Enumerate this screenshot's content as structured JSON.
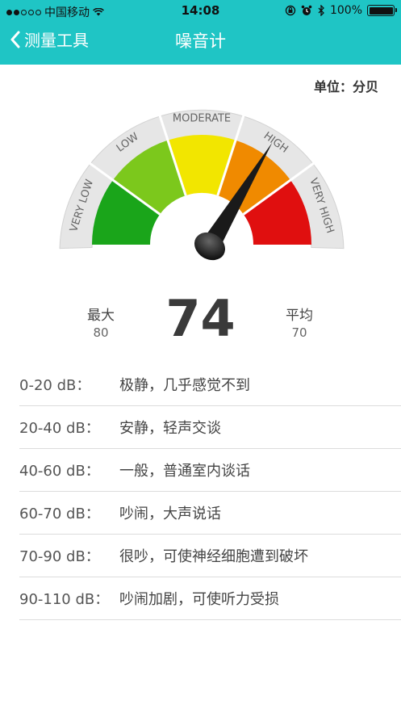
{
  "status_bar": {
    "carrier": "中国移动",
    "time": "14:08",
    "battery_text": "100%",
    "battery_level": 1.0,
    "signal_bars_filled": 2,
    "signal_bars_total": 5
  },
  "nav": {
    "back_label": "测量工具",
    "title": "噪音计",
    "background_color": "#1fc5c5"
  },
  "unit_label": "单位：分贝",
  "gauge": {
    "segments": [
      {
        "label": "VERY LOW",
        "color": "#1aa51a"
      },
      {
        "label": "LOW",
        "color": "#7cc81c"
      },
      {
        "label": "MODERATE",
        "color": "#f2e600"
      },
      {
        "label": "HIGH",
        "color": "#f08a00"
      },
      {
        "label": "VERY HIGH",
        "color": "#e00f0f"
      }
    ],
    "needle_value": 74
  },
  "stats": {
    "max_label": "最大",
    "max_value": "80",
    "current_value": "74",
    "avg_label": "平均",
    "avg_value": "70"
  },
  "legend": [
    {
      "range": "0-20 dB：",
      "desc": "极静，几乎感觉不到"
    },
    {
      "range": "20-40 dB：",
      "desc": "安静，轻声交谈"
    },
    {
      "range": "40-60 dB：",
      "desc": "一般，普通室内谈话"
    },
    {
      "range": "60-70 dB：",
      "desc": "吵闹，大声说话"
    },
    {
      "range": "70-90 dB：",
      "desc": "很吵，可使神经细胞遭到破坏"
    },
    {
      "range": "90-110 dB：",
      "desc": "吵闹加剧，可使听力受损"
    }
  ]
}
